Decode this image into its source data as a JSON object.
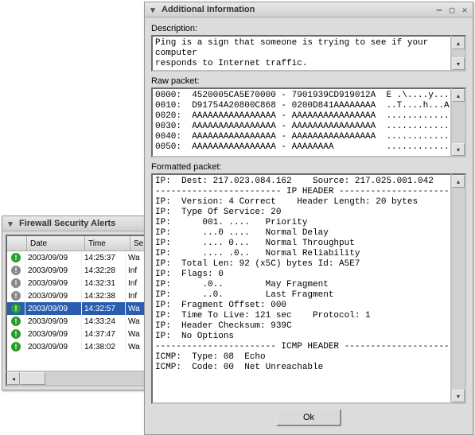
{
  "alerts_window": {
    "title": "Firewall Security Alerts",
    "columns": {
      "date": "Date",
      "time": "Time",
      "sev": "Se"
    },
    "rows": [
      {
        "icon": "green",
        "date": "2003/09/09",
        "time": "14:25:37",
        "sev": "Wa",
        "selected": false
      },
      {
        "icon": "grey",
        "date": "2003/09/09",
        "time": "14:32:28",
        "sev": "Inf",
        "selected": false
      },
      {
        "icon": "grey",
        "date": "2003/09/09",
        "time": "14:32:31",
        "sev": "Inf",
        "selected": false
      },
      {
        "icon": "grey",
        "date": "2003/09/09",
        "time": "14:32:38",
        "sev": "Inf",
        "selected": false
      },
      {
        "icon": "green",
        "date": "2003/09/09",
        "time": "14:32:57",
        "sev": "Wa",
        "selected": true
      },
      {
        "icon": "green",
        "date": "2003/09/09",
        "time": "14:33:24",
        "sev": "Wa",
        "selected": false
      },
      {
        "icon": "green",
        "date": "2003/09/09",
        "time": "14:37:47",
        "sev": "Wa",
        "selected": false
      },
      {
        "icon": "green",
        "date": "2003/09/09",
        "time": "14:38:02",
        "sev": "Wa",
        "selected": false
      }
    ]
  },
  "info_window": {
    "title": "Additional Information",
    "description_label": "Description:",
    "description_text": "Ping is a sign that someone is trying to see if your computer\nresponds to Internet traffic.",
    "raw_label": "Raw packet:",
    "raw_text": "0000:  4520005CA5E70000 - 7901939CD919012A  E .\\....y......*\n0010:  D91754A20800C868 - 0200D841AAAAAAAA  ..T....h...A....\n0020:  AAAAAAAAAAAAAAAA - AAAAAAAAAAAAAAAA  ................\n0030:  AAAAAAAAAAAAAAAA - AAAAAAAAAAAAAAAA  ................\n0040:  AAAAAAAAAAAAAAAA - AAAAAAAAAAAAAAAA  ................\n0050:  AAAAAAAAAAAAAAAA - AAAAAAAA          ............",
    "formatted_label": "Formatted packet:",
    "formatted_text": "IP:  Dest: 217.023.084.162    Source: 217.025.001.042\n------------------------ IP HEADER ------------------------\nIP:  Version: 4 Correct    Header Length: 20 bytes\nIP:  Type Of Service: 20\nIP:      001. ....   Priority\nIP:      ...0 ....   Normal Delay\nIP:      .... 0...   Normal Throughput\nIP:      .... .0..   Normal Reliability\nIP:  Total Len: 92 (x5C) bytes Id: A5E7\nIP:  Flags: 0\nIP:      .0..        May Fragment\nIP:      ..0.        Last Fragment\nIP:  Fragment Offset: 000\nIP:  Time To Live: 121 sec    Protocol: 1\nIP:  Header Checksum: 939C\nIP:  No Options\n----------------------- ICMP HEADER -----------------------\nICMP:  Type: 08  Echo\nICMP:  Code: 00  Net Unreachable",
    "ok_label": "Ok"
  }
}
